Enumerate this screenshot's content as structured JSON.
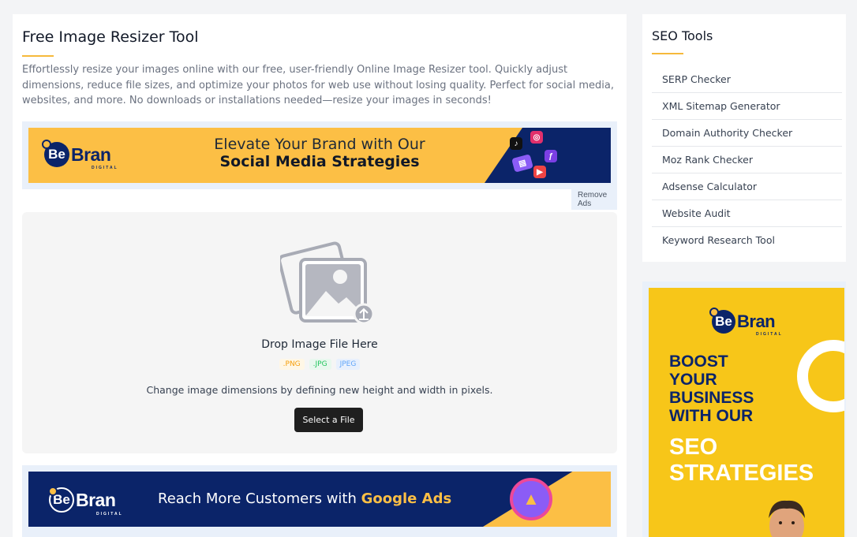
{
  "main": {
    "title": "Free Image Resizer Tool",
    "intro": "Effortlessly resize your images online with our free, user-friendly Online Image Resizer tool. Quickly adjust dimensions, reduce file sizes, and optimize your photos for web use without losing quality. Perfect for social media, websites, and more. No downloads or installations needed—resize your images in seconds!"
  },
  "ad_top": {
    "logo_be": "Be",
    "logo_bran": "Bran",
    "logo_sub": "DIGITAL",
    "line1": "Elevate Your Brand with Our",
    "line2": "Social Media Strategies",
    "remove_ads": "Remove Ads"
  },
  "upload": {
    "drop_title": "Drop Image File Here",
    "file_types": [
      ".PNG",
      ".JPG",
      "JPEG"
    ],
    "hint": "Change image dimensions by defining new height and width in pixels.",
    "button_label": "Select a File"
  },
  "ad_bottom": {
    "logo_be": "Be",
    "logo_bran": "Bran",
    "logo_sub": "DIGITAL",
    "text_plain": "Reach More Customers with ",
    "text_highlight": "Google Ads"
  },
  "sidebar": {
    "title": "SEO Tools",
    "items": [
      {
        "label": "SERP Checker"
      },
      {
        "label": "XML Sitemap Generator"
      },
      {
        "label": "Domain Authority Checker"
      },
      {
        "label": "Moz Rank Checker"
      },
      {
        "label": "Adsense Calculator"
      },
      {
        "label": "Website Audit"
      },
      {
        "label": "Keyword Research Tool"
      }
    ]
  },
  "side_ad": {
    "logo_be": "Be",
    "logo_bran": "Bran",
    "logo_sub": "DIGITAL",
    "line1": "BOOST",
    "line2": "YOUR",
    "line3": "BUSINESS",
    "line4": "WITH OUR",
    "line5": "SEO",
    "line6": "STRATEGIES"
  },
  "colors": {
    "accent": "#f6b93b",
    "ad_yellow": "#fcbf45",
    "brand_navy": "#0b2469",
    "button_dark": "#1f1f1f"
  }
}
